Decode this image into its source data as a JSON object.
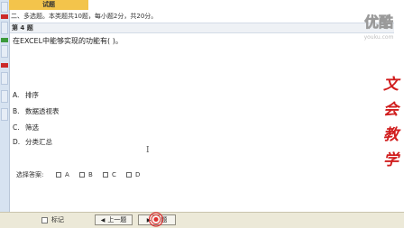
{
  "sidebar": {
    "accent_red": "#cc2a2a",
    "accent_green": "#3b9a3b"
  },
  "header": {
    "tab_title": "试题"
  },
  "instructions": "二、多选题。本类题共10题，每小题2分，共20分。",
  "question": {
    "number_label": "第 4 题",
    "text": "在EXCEL中能够实现的功能有(   )。",
    "options": [
      {
        "letter": "A.",
        "text": "排序"
      },
      {
        "letter": "B.",
        "text": "数据透视表"
      },
      {
        "letter": "C.",
        "text": "筛选"
      },
      {
        "letter": "D.",
        "text": "分类汇总"
      }
    ]
  },
  "answer": {
    "label": "选择答案:",
    "choices": [
      "A",
      "B",
      "C",
      "D"
    ]
  },
  "footer": {
    "mark_label": "标记",
    "prev_label": "上一题",
    "next_label": "题",
    "prev_icon": "triangle-left-icon",
    "next_icon": "triangle-right-icon"
  },
  "watermark": {
    "text": "优酷",
    "sub": "youku.com"
  },
  "brand_vertical": [
    "文",
    "会",
    "教",
    "学"
  ],
  "colors": {
    "title_yellow": "#f3c44b",
    "brand_red": "#d11e1e",
    "footer_bg": "#ece9d8"
  }
}
